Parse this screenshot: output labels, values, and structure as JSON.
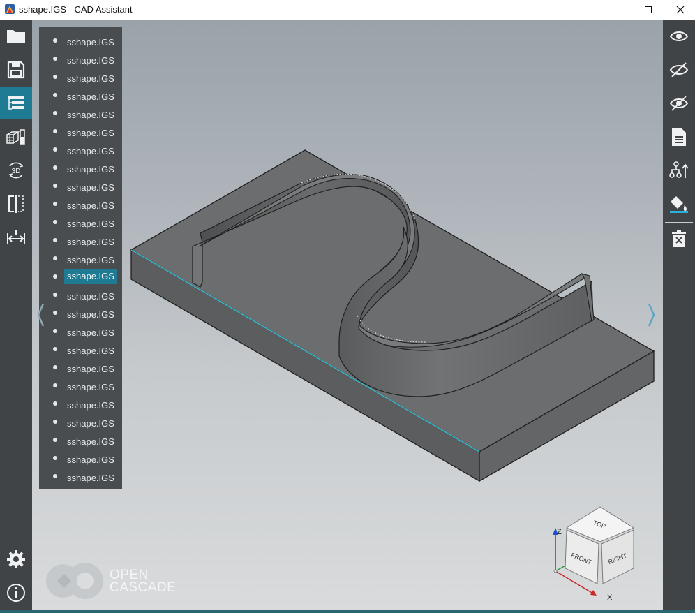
{
  "window": {
    "title": "sshape.IGS - CAD Assistant"
  },
  "left_toolbar": {
    "items": [
      {
        "icon": "folder-icon"
      },
      {
        "icon": "save-icon"
      },
      {
        "icon": "model-tree-icon",
        "active": true
      },
      {
        "icon": "display-mode-icon"
      },
      {
        "icon": "3d-view-icon"
      },
      {
        "icon": "clipping-plane-icon"
      },
      {
        "icon": "measure-icon"
      }
    ],
    "bottom_items": [
      {
        "icon": "gear-icon"
      },
      {
        "icon": "info-icon"
      }
    ]
  },
  "right_toolbar": {
    "items": [
      {
        "icon": "show-icon"
      },
      {
        "icon": "hide-icon"
      },
      {
        "icon": "show-only-icon"
      },
      {
        "icon": "properties-icon"
      },
      {
        "icon": "explode-icon"
      },
      {
        "icon": "paint-bucket-icon"
      },
      {
        "icon": "delete-icon"
      }
    ]
  },
  "model_tree": {
    "items": [
      {
        "label": "sshape.IGS"
      },
      {
        "label": "sshape.IGS"
      },
      {
        "label": "sshape.IGS"
      },
      {
        "label": "sshape.IGS"
      },
      {
        "label": "sshape.IGS"
      },
      {
        "label": "sshape.IGS"
      },
      {
        "label": "sshape.IGS"
      },
      {
        "label": "sshape.IGS"
      },
      {
        "label": "sshape.IGS"
      },
      {
        "label": "sshape.IGS"
      },
      {
        "label": "sshape.IGS"
      },
      {
        "label": "sshape.IGS"
      },
      {
        "label": "sshape.IGS"
      },
      {
        "label": "sshape.IGS",
        "selected": true
      },
      {
        "label": "sshape.IGS"
      },
      {
        "label": "sshape.IGS"
      },
      {
        "label": "sshape.IGS"
      },
      {
        "label": "sshape.IGS"
      },
      {
        "label": "sshape.IGS"
      },
      {
        "label": "sshape.IGS"
      },
      {
        "label": "sshape.IGS"
      },
      {
        "label": "sshape.IGS"
      },
      {
        "label": "sshape.IGS"
      },
      {
        "label": "sshape.IGS"
      },
      {
        "label": "sshape.IGS"
      }
    ]
  },
  "logo": {
    "line1": "OPEN",
    "line2": "CASCADE"
  },
  "view_cube": {
    "top": "TOP",
    "front": "FRONT",
    "right": "RIGHT",
    "axis_z": "Z",
    "axis_x": "X"
  },
  "colors": {
    "toolbar_bg": "#404447",
    "accent": "#1f7a93",
    "tree_bg": "#4a4d50",
    "model_face": "#6d6e6f",
    "highlight_edge": "#2ec4dc"
  }
}
